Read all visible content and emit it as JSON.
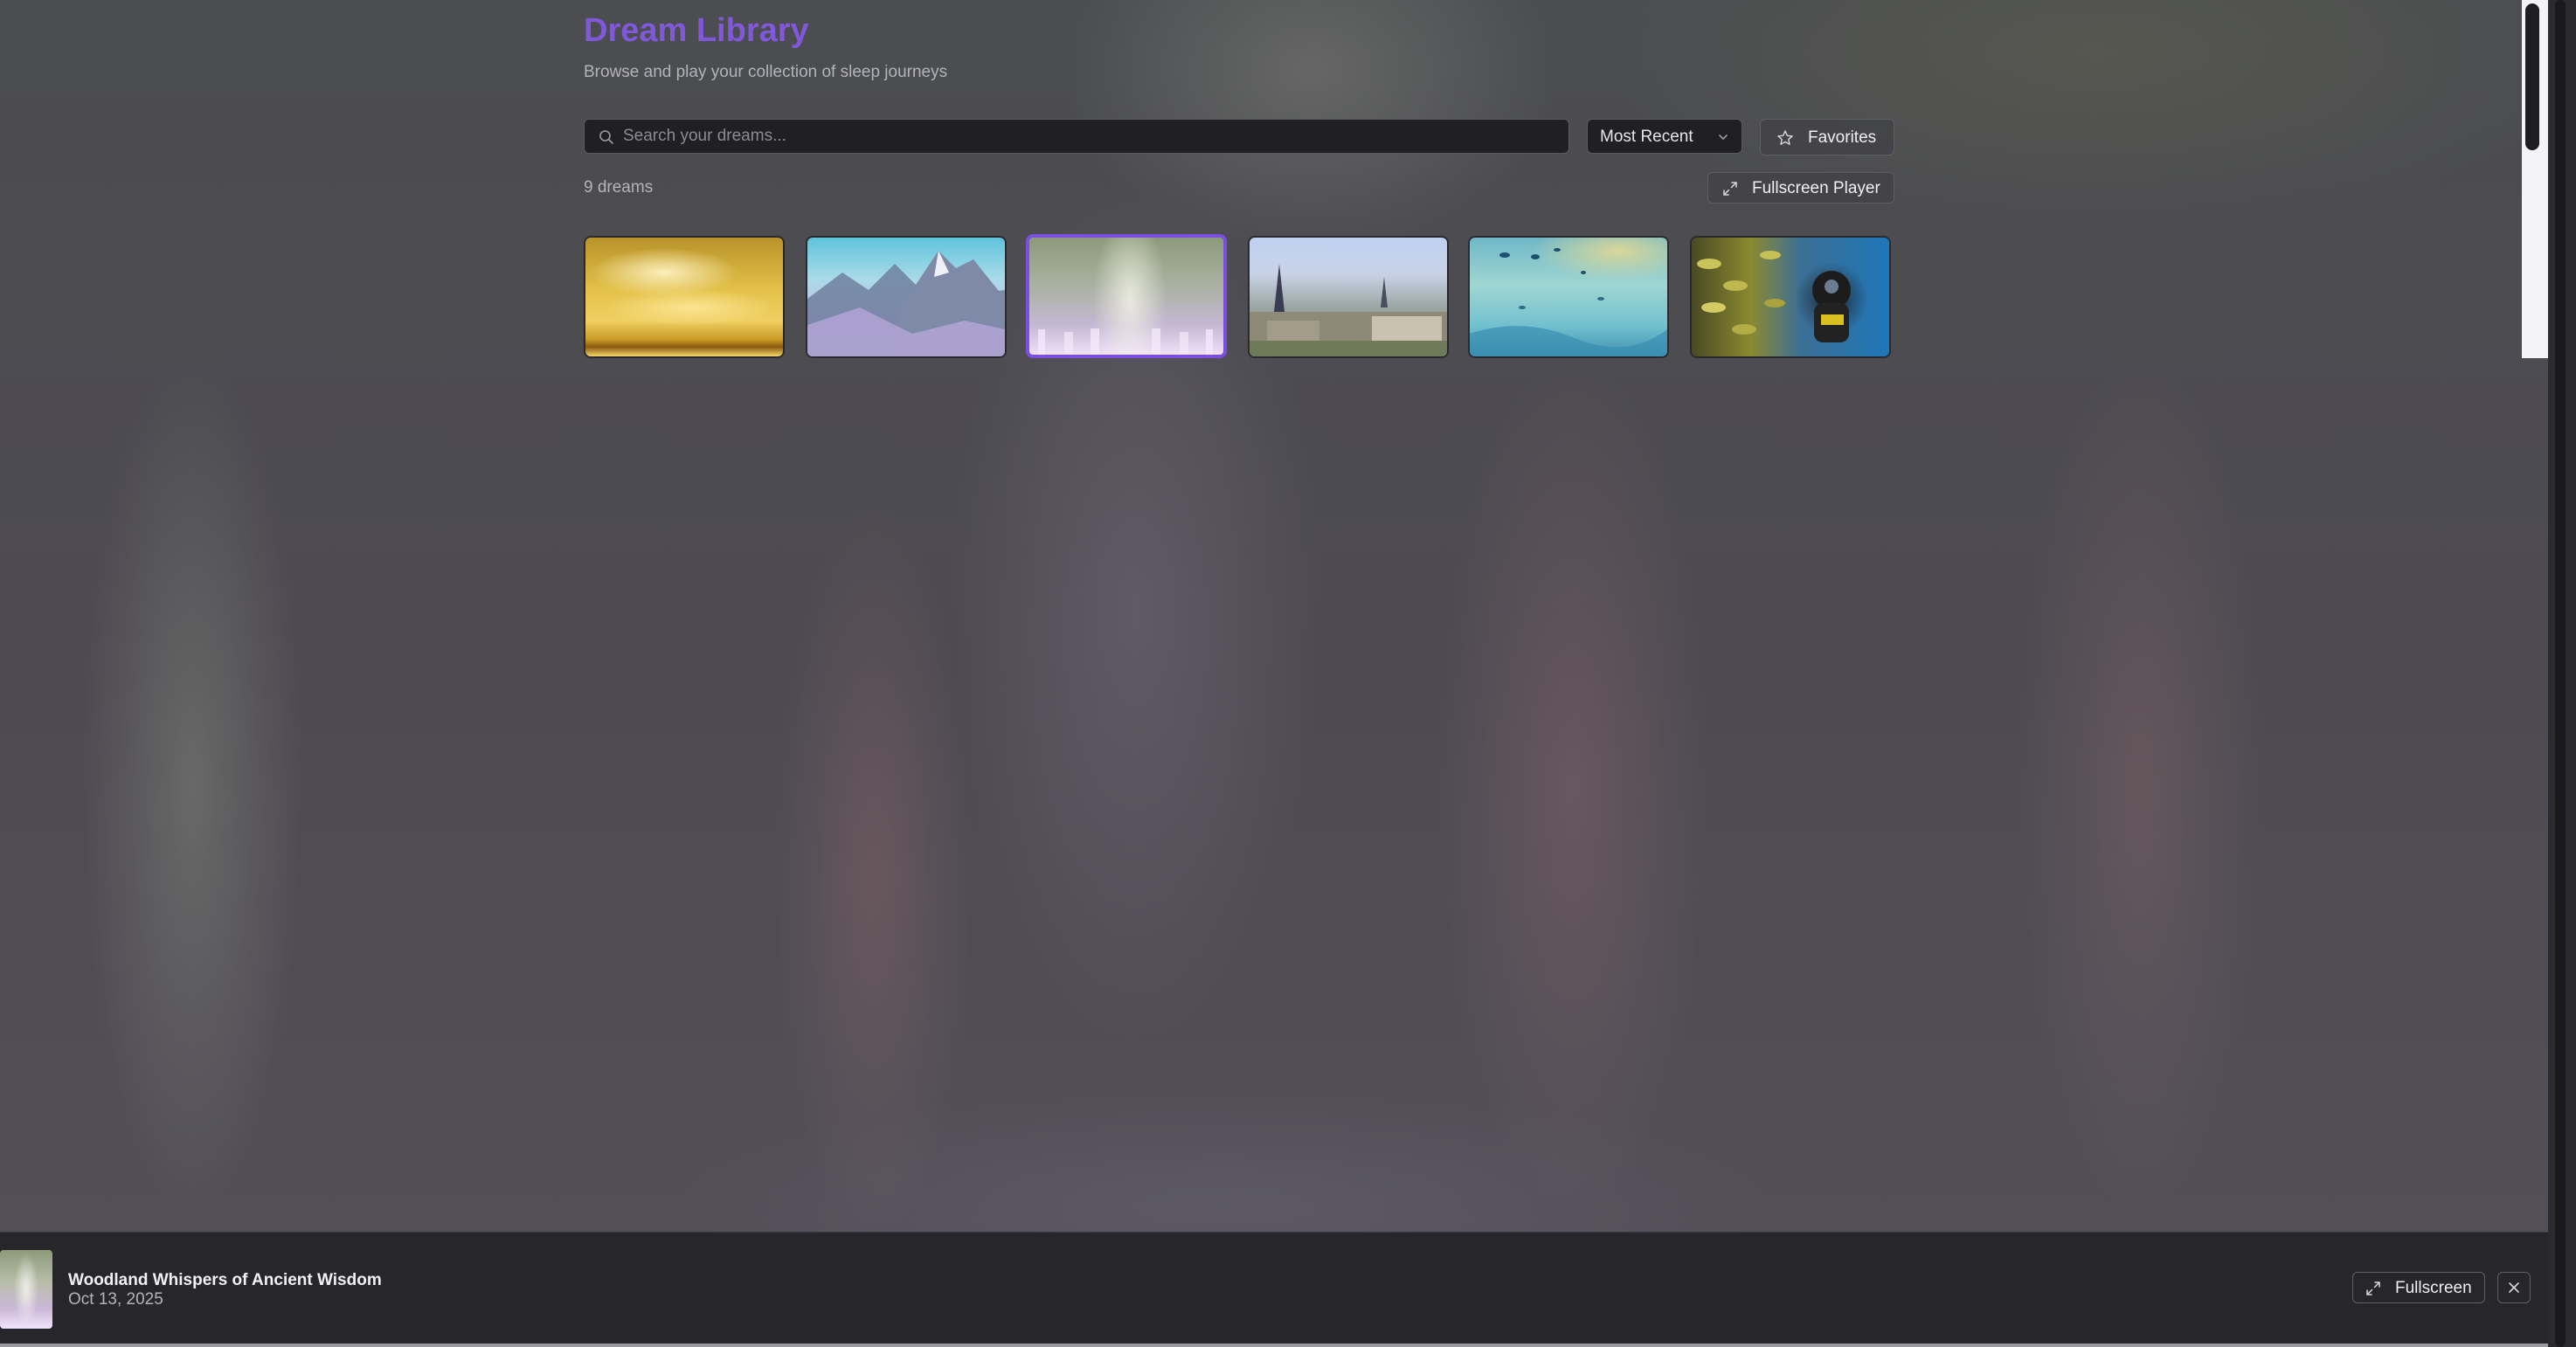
{
  "header": {
    "title": "Dream Library",
    "subtitle": "Browse and play your collection of sleep journeys"
  },
  "toolbar": {
    "search_placeholder": "Search your dreams...",
    "search_value": "",
    "sort_selected": "Most Recent",
    "favorites_label": "Favorites",
    "fullscreen_player_label": "Fullscreen Player"
  },
  "library": {
    "count_label": "9 dreams",
    "cards": [
      {
        "theme": "golden-sky",
        "selected": false
      },
      {
        "theme": "mountains",
        "selected": false
      },
      {
        "theme": "forest-light",
        "selected": true
      },
      {
        "theme": "city-skyline",
        "selected": false
      },
      {
        "theme": "ocean-fish",
        "selected": false
      },
      {
        "theme": "scuba-diver",
        "selected": false
      }
    ]
  },
  "player": {
    "title": "Woodland Whispers of Ancient Wisdom",
    "date": "Oct 13, 2025",
    "fullscreen_label": "Fullscreen"
  },
  "colors": {
    "accent": "#8158d9",
    "selected_border": "#7b4fe0",
    "player_bg": "#27272b"
  },
  "icons": [
    "search-icon",
    "chevron-down-icon",
    "star-icon",
    "expand-icon",
    "close-icon"
  ]
}
